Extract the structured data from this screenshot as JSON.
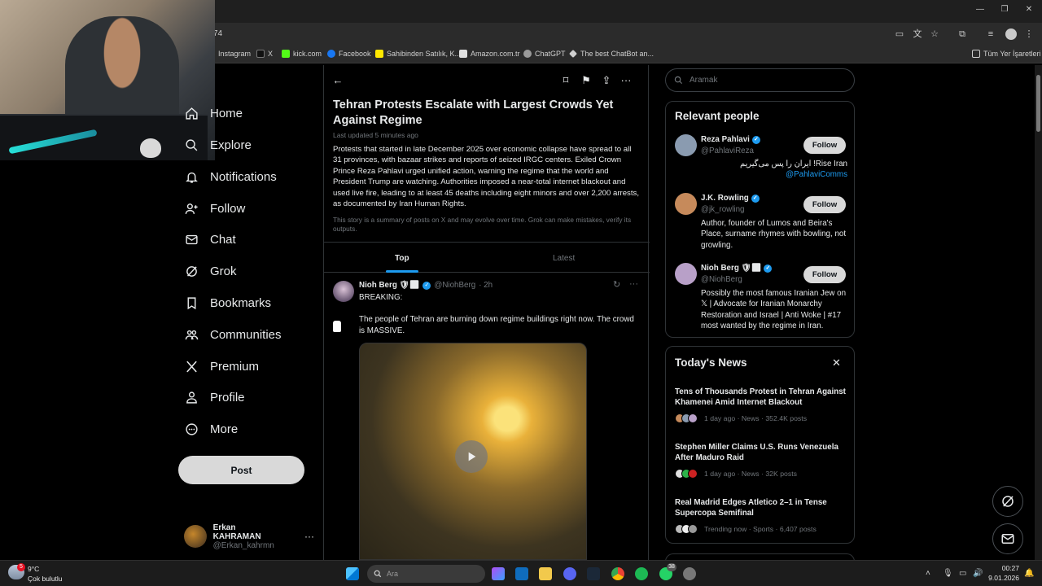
{
  "browser": {
    "url_fragment": "74",
    "bookmarks": [
      {
        "label": "Instagram",
        "color": "#c13584"
      },
      {
        "label": "X",
        "color": "#000000"
      },
      {
        "label": "kick.com",
        "color": "#53fc18"
      },
      {
        "label": "Facebook",
        "color": "#1877f2"
      },
      {
        "label": "Sahibinden Satılık, K...",
        "color": "#ffe800"
      },
      {
        "label": "Amazon.com.tr",
        "color": "#e0e0e0"
      },
      {
        "label": "ChatGPT",
        "color": "#9a9a9a"
      },
      {
        "label": "The best ChatBot an...",
        "color": "#cfcfcf"
      }
    ],
    "all_bookmarks_label": "Tüm Yer İşaretleri"
  },
  "nav": {
    "items": [
      {
        "label": "Home",
        "icon": "home-icon"
      },
      {
        "label": "Explore",
        "icon": "search-icon"
      },
      {
        "label": "Notifications",
        "icon": "bell-icon"
      },
      {
        "label": "Follow",
        "icon": "follow-icon"
      },
      {
        "label": "Chat",
        "icon": "mail-icon"
      },
      {
        "label": "Grok",
        "icon": "grok-icon"
      },
      {
        "label": "Bookmarks",
        "icon": "bookmark-icon"
      },
      {
        "label": "Communities",
        "icon": "communities-icon"
      },
      {
        "label": "Premium",
        "icon": "x-logo-icon"
      },
      {
        "label": "Profile",
        "icon": "person-icon"
      },
      {
        "label": "More",
        "icon": "more-circle-icon"
      }
    ],
    "post_label": "Post",
    "account": {
      "name": "Erkan KAHRAMAN",
      "handle": "@Erkan_kahrmn"
    }
  },
  "story": {
    "title": "Tehran Protests Escalate with Largest Crowds Yet Against Regime",
    "updated": "Last updated 5 minutes ago",
    "body": "Protests that started in late December 2025 over economic collapse have spread to all 31 provinces, with bazaar strikes and reports of seized IRGC centers. Exiled Crown Prince Reza Pahlavi urged unified action, warning the regime that the world and President Trump are watching. Authorities imposed a near-total internet blackout and used live fire, leading to at least 45 deaths including eight minors and over 2,200 arrests, as documented by Iran Human Rights.",
    "note": "This story is a summary of posts on X and may evolve over time. Grok can make mistakes, verify its outputs.",
    "tabs": [
      "Top",
      "Latest"
    ]
  },
  "tweet": {
    "name": "Nioh Berg 🛡✡",
    "handle": "@NiohBerg",
    "time": "· 2h",
    "text1": "BREAKING:",
    "text2": "The people of Tehran are burning down regime buildings right now. The crowd is MASSIVE."
  },
  "search": {
    "placeholder": "Aramak"
  },
  "people": {
    "title": "Relevant people",
    "follow_label": "Follow",
    "list": [
      {
        "name": "Reza Pahlavi",
        "handle": "@PahlaviReza",
        "bio": "ایران را پس می‌گیریم !Rise Iran",
        "link": "@PahlaviComms",
        "color": "#8a9bb0"
      },
      {
        "name": "J.K. Rowling",
        "handle": "@jk_rowling",
        "bio": "Author, founder of Lumos and Beira's Place, surname rhymes with bowling, not growling.",
        "link": "",
        "color": "#c68a5b"
      },
      {
        "name": "Nioh Berg 🛡✡",
        "handle": "@NiohBerg",
        "bio": "Possibly the most famous Iranian Jew on 𝕏 | Advocate for Iranian Monarchy Restoration and Israel | Anti Woke | #17 most wanted by the regime in Iran.",
        "link": "",
        "color": "#b8a0c8"
      }
    ]
  },
  "news": {
    "title": "Today's News",
    "items": [
      {
        "title": "Tens of Thousands Protest in Tehran Against Khamenei Amid Internet Blackout",
        "meta": "1 day ago · News · 352.4K posts"
      },
      {
        "title": "Stephen Miller Claims U.S. Runs Venezuela After Maduro Raid",
        "meta": "1 day ago · News · 32K posts"
      },
      {
        "title": "Real Madrid Edges Atletico 2–1 in Tense Supercopa Semifinal",
        "meta": "Trending now · Sports · 6,407 posts"
      }
    ]
  },
  "taskbar": {
    "weather_temp": "9°C",
    "weather_desc": "Çok bulutlu",
    "weather_badge": "5",
    "search_placeholder": "Ara",
    "time": "00:27",
    "date": "9.01.2026",
    "whatsapp_badge": "38"
  }
}
